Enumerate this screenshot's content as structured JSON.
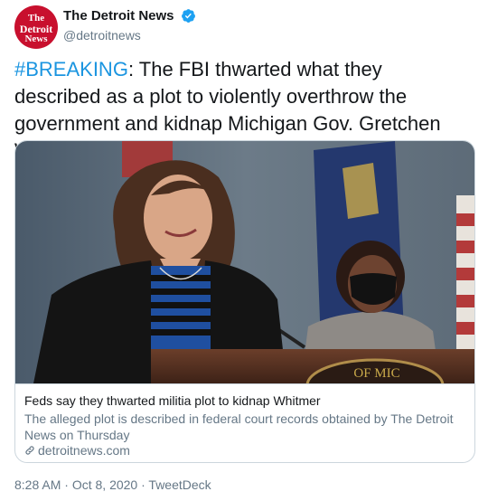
{
  "account": {
    "display_name": "The Detroit News",
    "handle": "@detroitnews",
    "verified_icon": "verified-badge-icon",
    "avatar_text": [
      "The",
      "Detroit",
      "News"
    ]
  },
  "tweet": {
    "hashtag": "#BREAKING",
    "text": ": The FBI thwarted what they described as a plot to violently overthrow the government and kidnap Michigan Gov. Gretchen Whitmer."
  },
  "card": {
    "image_caption": "OF MIC",
    "title": "Feds say they thwarted militia plot to kidnap Whitmer",
    "description": "The alleged plot is described in federal court records obtained by The Detroit News on Thursday",
    "domain": "detroitnews.com",
    "link_icon": "link-icon"
  },
  "meta": {
    "time": "8:28 AM",
    "separator1": " · ",
    "date": "Oct 8, 2020",
    "separator2": " · ",
    "source": "TweetDeck"
  },
  "colors": {
    "hashtag": "#1b95e0",
    "verified": "#1da1f2",
    "avatar_bg": "#c8102e",
    "secondary_text": "#657786",
    "border": "#ccd6dd"
  }
}
